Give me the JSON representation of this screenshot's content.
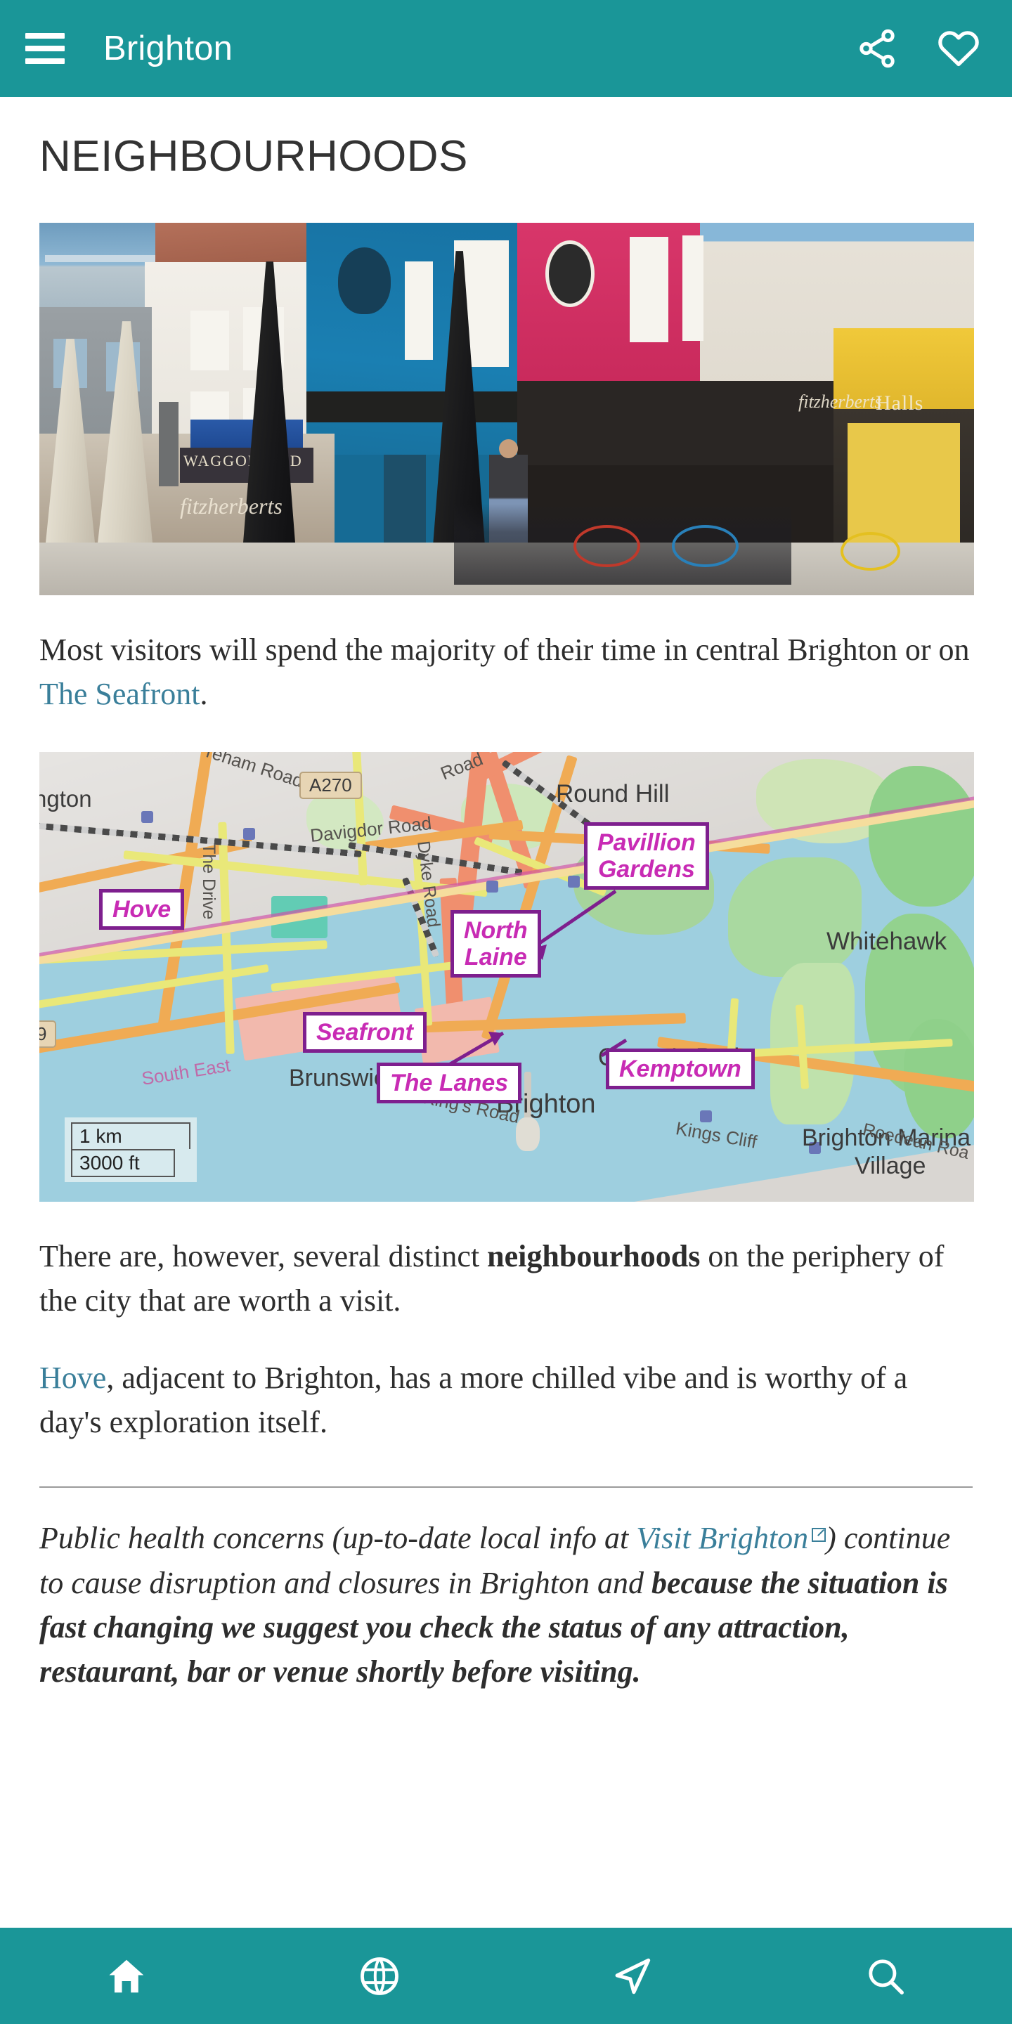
{
  "appbar": {
    "menu_icon": "hamburger-menu-icon",
    "title": "Brighton",
    "share_icon": "share-icon",
    "favorite_icon": "heart-icon"
  },
  "colors": {
    "brand_teal": "#1a9698",
    "link_blue": "#3a7f9a",
    "map_highlight_border": "#7e1f8e",
    "map_highlight_text": "#c82bb4",
    "body_text": "#2d2d2d"
  },
  "page": {
    "title": "NEIGHBOURHOODS"
  },
  "photo": {
    "alt": "Brighton street scene with colourful shopfronts, cafe umbrellas and bicycles",
    "sign_waggon": "WAGGON AND",
    "sign_fitzherberts": "fitzherberts",
    "sign_halls": "Halls"
  },
  "paragraph_1": {
    "part_1": "Most visitors will spend the majority of their time in central Brighton or on ",
    "link": "The Seafront",
    "part_2": "."
  },
  "map": {
    "alt": "Map of Brighton and Hove showing neighbourhoods",
    "highlight_labels": [
      {
        "id": "hove",
        "text": "Hove"
      },
      {
        "id": "north-laine",
        "text": "North\nLaine"
      },
      {
        "id": "pavillion-gardens",
        "text": "Pavillion\nGardens"
      },
      {
        "id": "seafront",
        "text": "Seafront"
      },
      {
        "id": "the-lanes",
        "text": "The Lanes"
      },
      {
        "id": "kemptown",
        "text": "Kemptown"
      }
    ],
    "place_labels": [
      "ngton",
      "Round Hill",
      "Whitehawk",
      "Queen's Park",
      "Brunswick",
      "Brighton",
      "Brighton Marina",
      "Village"
    ],
    "road_labels": [
      "A270",
      "reham Road",
      "Davigdor Road",
      "The Drive",
      "Dyke Road",
      "King's Road",
      "Kings Cliff",
      "Roedean Roa",
      "South East",
      "Road"
    ],
    "route_badge": "A270",
    "route_badge_2": "9",
    "scale": {
      "metric": "1 km",
      "imperial": "3000 ft"
    }
  },
  "paragraph_2": {
    "part_1": "There are, however, several distinct ",
    "bold": "neighbourhoods",
    "part_2": " on the periphery of the city that are worth a visit."
  },
  "paragraph_3": {
    "link": "Hove",
    "part_1": ", adjacent to Brighton, has a more chilled vibe and is worthy of a day's exploration itself."
  },
  "notice": {
    "part_1": "Public health concerns (up-to-date local info at ",
    "link": "Visit Brighton",
    "external_icon": "external-link-icon",
    "part_2": ") continue to cause disruption and closures in Brighton and ",
    "bold": "because the situation is fast changing we suggest you check the status of any attraction, restaurant, bar or venue shortly before visiting."
  },
  "bottomnav": {
    "items": [
      {
        "id": "home",
        "icon": "home-icon"
      },
      {
        "id": "explore",
        "icon": "globe-icon"
      },
      {
        "id": "nearby",
        "icon": "navigation-arrow-icon"
      },
      {
        "id": "search",
        "icon": "search-icon"
      }
    ]
  }
}
